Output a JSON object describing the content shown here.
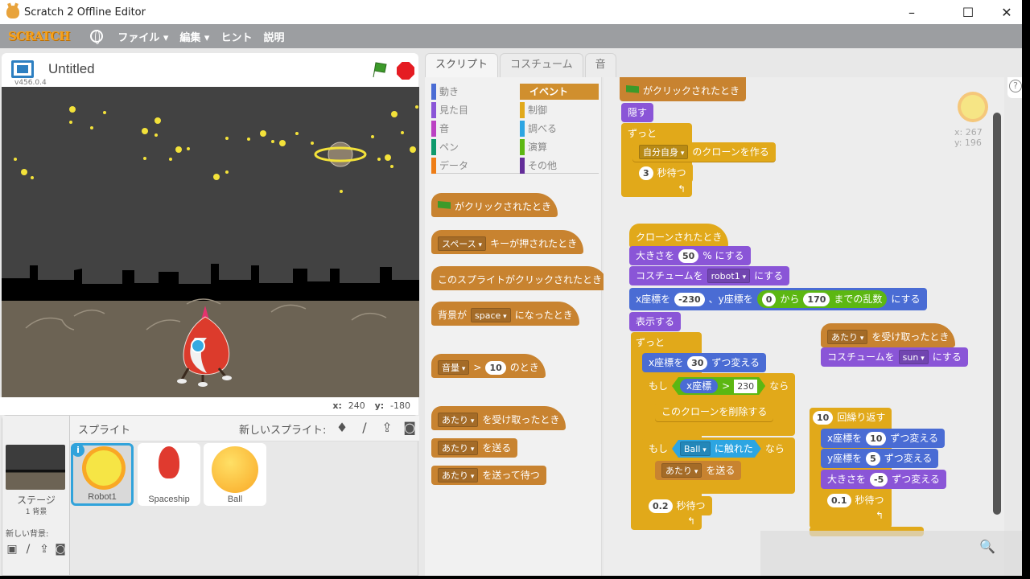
{
  "window": {
    "title": "Scratch 2 Offline Editor",
    "minimize": "–",
    "maximize": "☐",
    "close": "✕"
  },
  "menubar": {
    "logo": "SCRATCH",
    "items": [
      "ファイル ▾",
      "編集 ▾",
      "ヒント",
      "説明"
    ]
  },
  "toolbar": {
    "icons": [
      "duplicate-icon",
      "delete-icon",
      "grow-icon",
      "shrink-icon",
      "help-icon"
    ],
    "help": "?"
  },
  "stage": {
    "project_title": "Untitled",
    "version": "v456.0.4",
    "mouse_x_label": "x:",
    "mouse_x": "240",
    "mouse_y_label": "y:",
    "mouse_y": "-180"
  },
  "sprites": {
    "header": "スプライト",
    "new_sprite_label": "新しいスプライト:",
    "stage_label": "ステージ",
    "backdrop_count": "1 背景",
    "new_backdrop_label": "新しい背景:",
    "items": [
      {
        "name": "Robot1",
        "selected": true
      },
      {
        "name": "Spaceship",
        "selected": false
      },
      {
        "name": "Ball",
        "selected": false
      }
    ]
  },
  "tabs": [
    "スクリプト",
    "コスチューム",
    "音"
  ],
  "categories": {
    "left": [
      {
        "label": "動き",
        "color": "#4a6cd4"
      },
      {
        "label": "見た目",
        "color": "#8a55d7"
      },
      {
        "label": "音",
        "color": "#bb42c3"
      },
      {
        "label": "ペン",
        "color": "#0e9a6c"
      },
      {
        "label": "データ",
        "color": "#ee7d16"
      }
    ],
    "right": [
      {
        "label": "イベント",
        "color": "#c88330",
        "active": true
      },
      {
        "label": "制御",
        "color": "#e1a91a"
      },
      {
        "label": "調べる",
        "color": "#2ca5e2"
      },
      {
        "label": "演算",
        "color": "#5cb712"
      },
      {
        "label": "その他",
        "color": "#632d99"
      }
    ]
  },
  "palette": {
    "flag_clicked": "がクリックされたとき",
    "key_dd": "スペース",
    "key_pressed": "キーが押されたとき",
    "sprite_clicked": "このスプライトがクリックされたとき",
    "backdrop_prefix": "背景が",
    "backdrop_dd": "space",
    "backdrop_suffix": "になったとき",
    "sensor_dd": "音量",
    "gt": ">",
    "sensor_val": "10",
    "sensor_suffix": "のとき",
    "msg_dd": "あたり",
    "receive": "を受け取ったとき",
    "broadcast": "を送る",
    "broadcast_wait": "を送って待つ"
  },
  "scripts": {
    "s1": {
      "hat": "がクリックされたとき",
      "hide": "隠す",
      "forever": "ずっと",
      "clone_dd": "自分自身",
      "clone_text": "のクローンを作る",
      "wait_val": "3",
      "wait_text": "秒待つ"
    },
    "s2": {
      "hat": "クローンされたとき",
      "size_pre": "大きさを",
      "size_val": "50",
      "size_post": "% にする",
      "costume_pre": "コスチュームを",
      "costume_dd": "robot1",
      "costume_post": "にする",
      "goto_x_pre": "x座標を",
      "goto_x": "-230",
      "goto_y_pre": "、y座標を",
      "rand_from": "0",
      "rand_mid": "から",
      "rand_to": "170",
      "rand_post": "までの乱数",
      "goto_post": "にする",
      "show": "表示する",
      "forever": "ずっと",
      "changex_pre": "x座標を",
      "changex_val": "30",
      "changex_post": "ずつ変える",
      "if1": "もし",
      "xpos": "x座標",
      "gt": ">",
      "gt_val": "230",
      "then1": "なら",
      "delete_clone": "このクローンを削除する",
      "if2": "もし",
      "touch_dd": "Ball",
      "touch_post": "に触れた",
      "then2": "なら",
      "bc_dd": "あたり",
      "bc_post": "を送る",
      "wait_val": "0.2",
      "wait_text": "秒待つ"
    },
    "s3": {
      "hat_dd": "あたり",
      "hat_post": "を受け取ったとき",
      "costume_pre": "コスチュームを",
      "costume_dd": "sun",
      "costume_post": "にする"
    },
    "s4": {
      "repeat_val": "10",
      "repeat_text": "回繰り返す",
      "cx_pre": "x座標を",
      "cx_val": "10",
      "cx_post": "ずつ変える",
      "cy_pre": "y座標を",
      "cy_val": "5",
      "cy_post": "ずつ変える",
      "cs_pre": "大きさを",
      "cs_val": "-5",
      "cs_post": "ずつ変える",
      "wait_val": "0.1",
      "wait_text": "秒待つ"
    }
  },
  "sprite_info": {
    "x_label": "x:",
    "x": "267",
    "y_label": "y:",
    "y": "196"
  },
  "zoom_icon": "🔍"
}
